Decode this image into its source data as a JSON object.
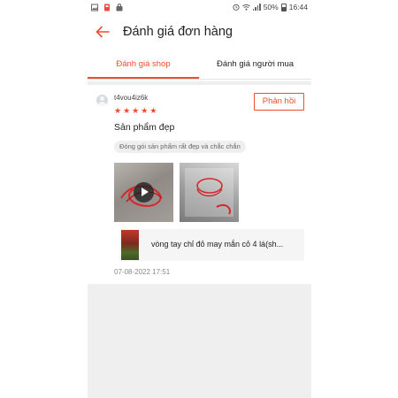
{
  "status_bar": {
    "battery_text": "50%",
    "time": "16:44",
    "icons": [
      "gallery-icon",
      "flag-icon",
      "shopping-bag-icon",
      "alarm-icon",
      "wifi-icon",
      "signal-icon",
      "battery-icon"
    ]
  },
  "header": {
    "title": "Đánh giá đơn hàng",
    "back_icon": "arrow-left-icon"
  },
  "tabs": [
    {
      "label": "Đánh giá shop",
      "active": true
    },
    {
      "label": "Đánh giá người mua",
      "active": false
    }
  ],
  "review": {
    "username": "t4vou4iz6k",
    "rating": 5,
    "reply_label": "Phản hồi",
    "text": "Sản phẩm đẹp",
    "tag": "Đóng gói sản phẩm rất đẹp và chắc chắn",
    "media": [
      {
        "type": "video",
        "icon": "play-icon"
      },
      {
        "type": "image"
      }
    ],
    "product_name": "vòng tay chỉ đỏ may mắn cỏ 4 lá(sh...",
    "date": "07-08-2022 17:51"
  },
  "colors": {
    "accent": "#ee4d2d",
    "background": "#efefef",
    "text": "#222222"
  }
}
